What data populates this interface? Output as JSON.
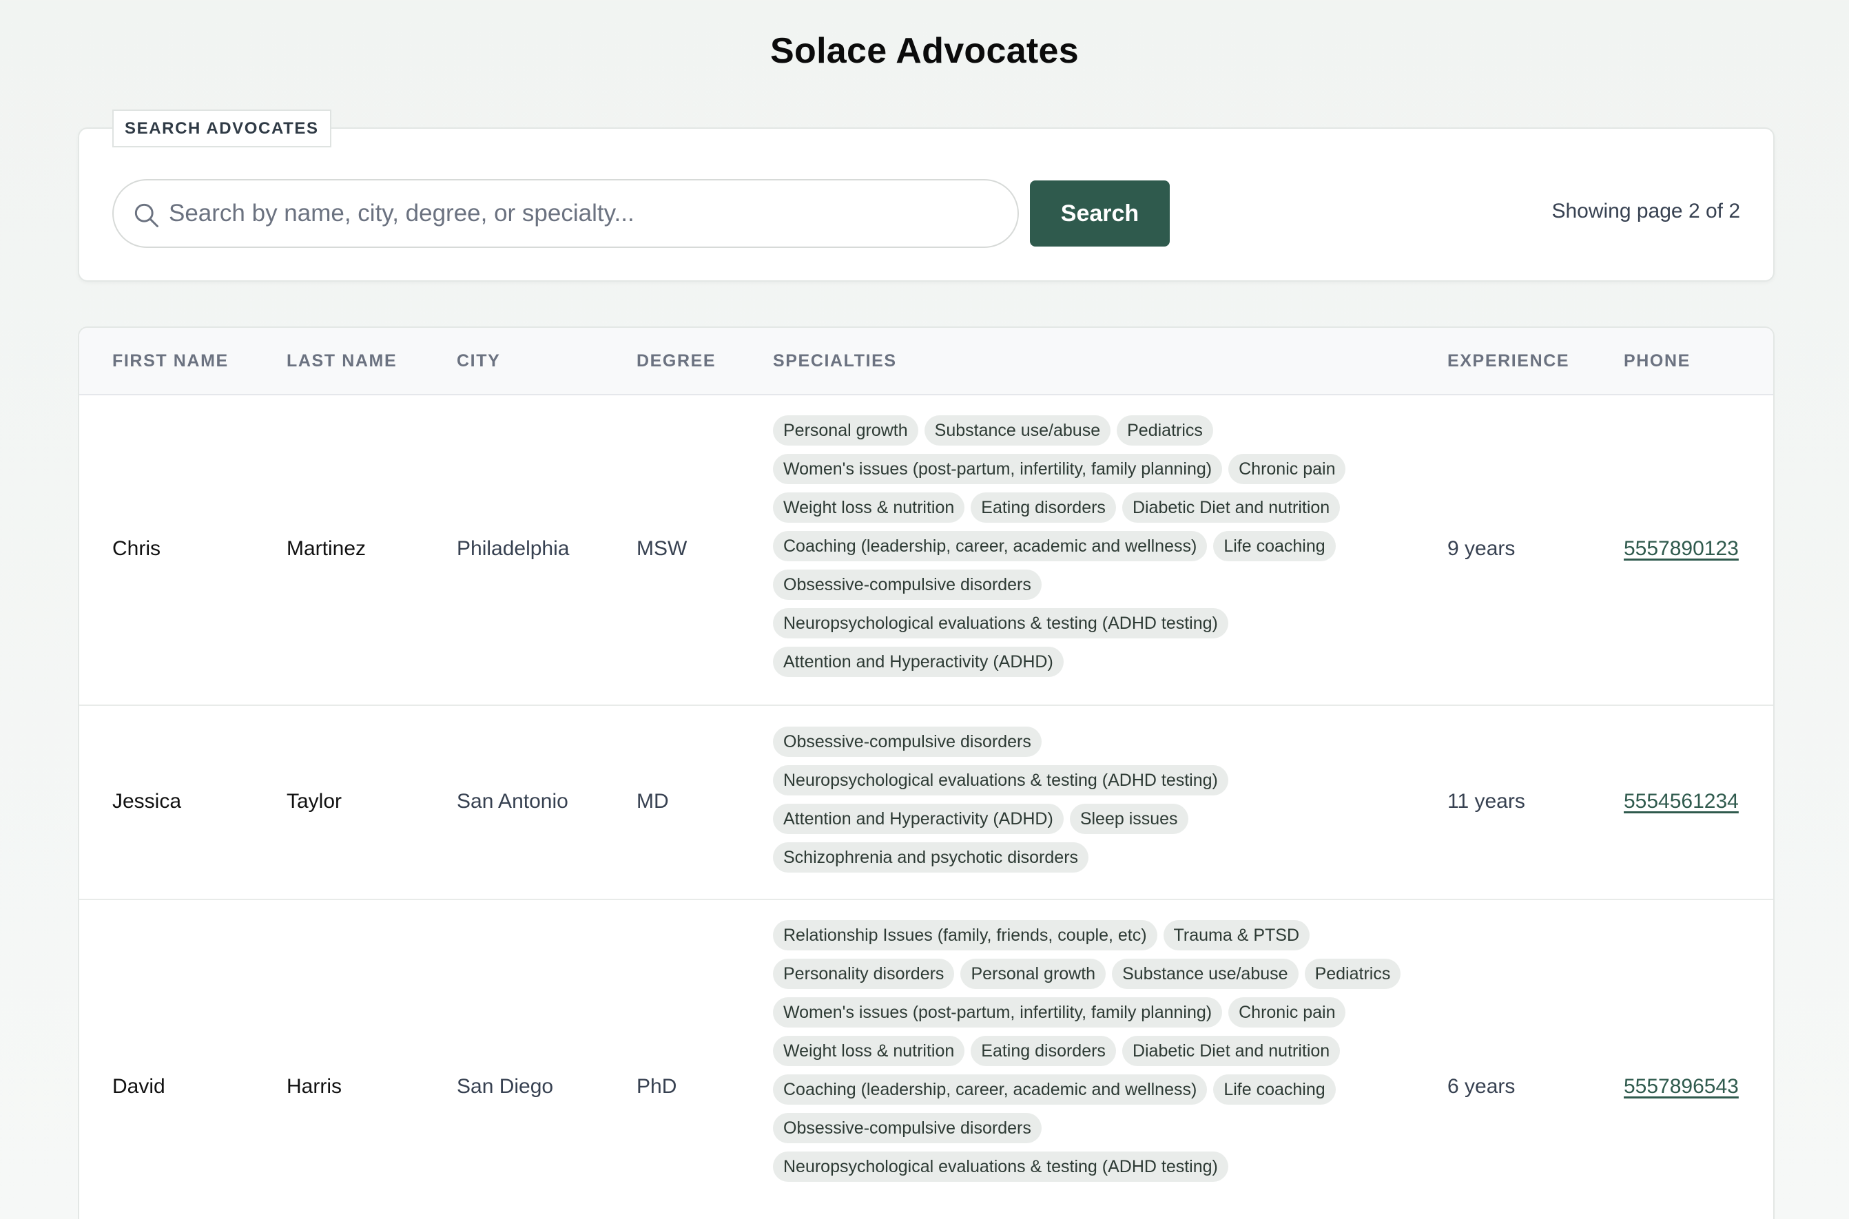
{
  "title": "Solace Advocates",
  "search": {
    "legend": "SEARCH ADVOCATES",
    "placeholder": "Search by name, city, degree, or specialty...",
    "button_label": "Search",
    "status": "Showing page 2 of 2"
  },
  "table": {
    "headers": [
      "FIRST NAME",
      "LAST NAME",
      "CITY",
      "DEGREE",
      "SPECIALTIES",
      "EXPERIENCE",
      "PHONE"
    ],
    "rows": [
      {
        "first": "Chris",
        "last": "Martinez",
        "city": "Philadelphia",
        "degree": "MSW",
        "experience": "9 years",
        "phone": "5557890123",
        "specialties": [
          "Personal growth",
          "Substance use/abuse",
          "Pediatrics",
          "Women's issues (post-partum, infertility, family planning)",
          "Chronic pain",
          "Weight loss & nutrition",
          "Eating disorders",
          "Diabetic Diet and nutrition",
          "Coaching (leadership, career, academic and wellness)",
          "Life coaching",
          "Obsessive-compulsive disorders",
          "Neuropsychological evaluations & testing (ADHD testing)",
          "Attention and Hyperactivity (ADHD)"
        ]
      },
      {
        "first": "Jessica",
        "last": "Taylor",
        "city": "San Antonio",
        "degree": "MD",
        "experience": "11 years",
        "phone": "5554561234",
        "specialties": [
          "Obsessive-compulsive disorders",
          "Neuropsychological evaluations & testing (ADHD testing)",
          "Attention and Hyperactivity (ADHD)",
          "Sleep issues",
          "Schizophrenia and psychotic disorders"
        ]
      },
      {
        "first": "David",
        "last": "Harris",
        "city": "San Diego",
        "degree": "PhD",
        "experience": "6 years",
        "phone": "5557896543",
        "specialties": [
          "Relationship Issues (family, friends, couple, etc)",
          "Trauma & PTSD",
          "Personality disorders",
          "Personal growth",
          "Substance use/abuse",
          "Pediatrics",
          "Women's issues (post-partum, infertility, family planning)",
          "Chronic pain",
          "Weight loss & nutrition",
          "Eating disorders",
          "Diabetic Diet and nutrition",
          "Coaching (leadership, career, academic and wellness)",
          "Life coaching",
          "Obsessive-compulsive disorders",
          "Neuropsychological evaluations & testing (ADHD testing)"
        ]
      }
    ]
  },
  "colors": {
    "accent": "#2f5a4d",
    "tag_bg": "#e9ecea",
    "page_bg": "#f3f6f4"
  }
}
